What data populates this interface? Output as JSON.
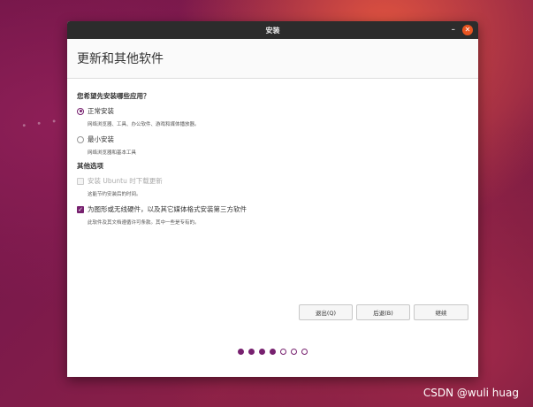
{
  "window": {
    "title": "安装"
  },
  "page": {
    "title": "更新和其他软件"
  },
  "question": "您希望先安装哪些应用？",
  "install_options": [
    {
      "label": "正常安装",
      "description": "网络浏览器、工具、办公软件、游戏和媒体播放器。",
      "selected": true
    },
    {
      "label": "最小安装",
      "description": "网络浏览器和基本工具",
      "selected": false
    }
  ],
  "other_options": {
    "title": "其他选项",
    "items": [
      {
        "label": "安装 Ubuntu 时下载更新",
        "description": "这能节约安装后的时间。",
        "checked": false,
        "disabled": true
      },
      {
        "label": "为图形或无线硬件，以及其它媒体格式安装第三方软件",
        "description": "此软件及其文档遵循许可条款。其中一些是专有的。",
        "checked": true,
        "disabled": false
      }
    ]
  },
  "buttons": {
    "quit": "退出(Q)",
    "back": "后退(B)",
    "continue": "继续"
  },
  "progress": {
    "total_steps": 7,
    "completed_steps": 4
  },
  "watermark": "CSDN @wuli huag",
  "colors": {
    "accent": "#77216f",
    "close": "#e95420",
    "titlebar": "#2c2c2c"
  },
  "icons": {
    "close": "close-icon",
    "minimize": "minimize-icon"
  }
}
